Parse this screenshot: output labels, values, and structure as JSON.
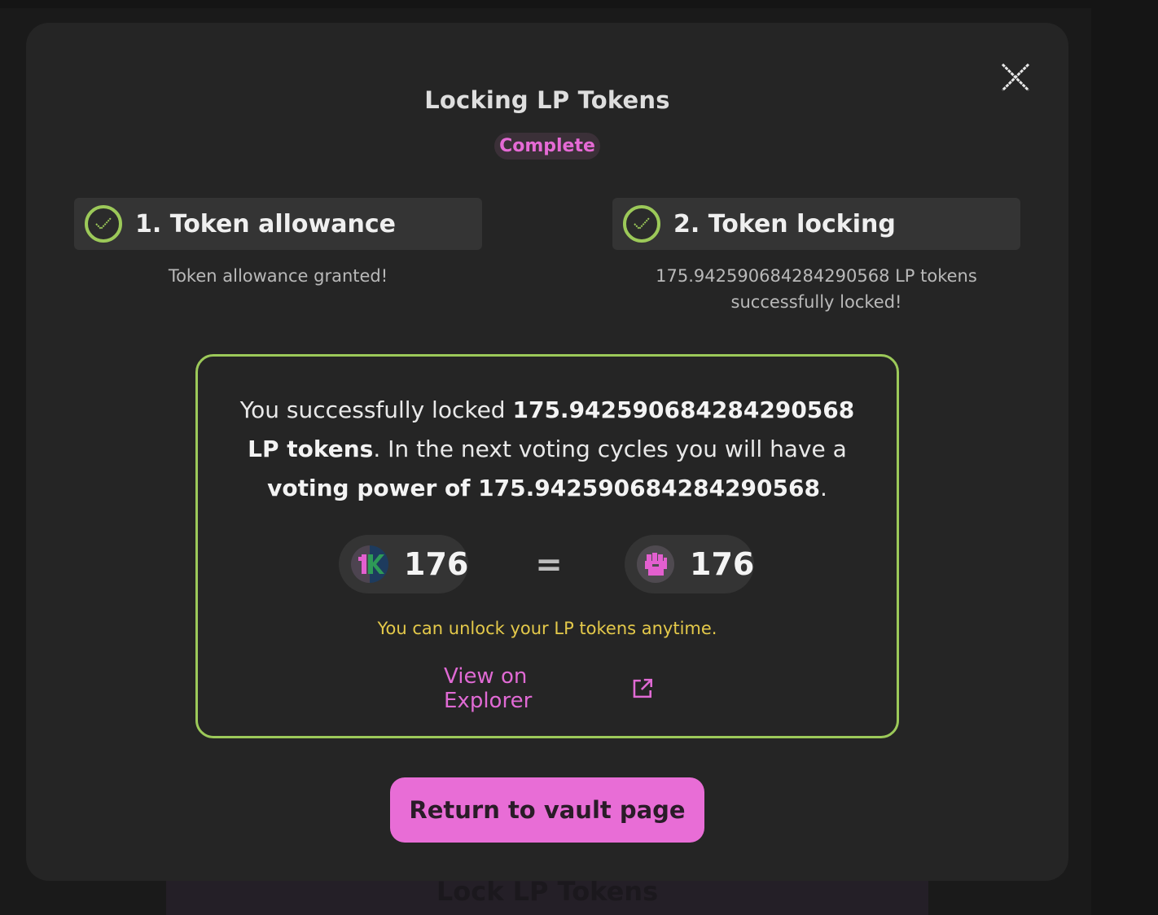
{
  "background": {
    "behind_button_label": "Lock LP Tokens"
  },
  "modal": {
    "title": "Locking LP Tokens",
    "status": "Complete",
    "steps": [
      {
        "label": "1. Token allowance",
        "state": "done",
        "description": "Token allowance granted!"
      },
      {
        "label": "2. Token locking",
        "state": "done",
        "description": "175.942590684284290568 LP tokens successfully locked!"
      }
    ],
    "success": {
      "text_1": "You successfully locked ",
      "locked_amount": "175.942590684284290568 LP tokens",
      "text_2": ". In the next voting cycles you will have a ",
      "voting_power": "voting power of 175.942590684284290568",
      "text_3": ".",
      "lp_value": "176",
      "equals": "=",
      "vp_value": "176",
      "unlock_note": "You can unlock your LP tokens anytime.",
      "explorer_link": "View on Explorer"
    },
    "return_button": "Return to vault page"
  },
  "icons": {
    "close": "close-icon",
    "check": "check-circle-icon",
    "lp_token": "lp-token-icon",
    "voting_power": "voting-power-fist-icon",
    "external_link": "external-link-icon"
  },
  "colors": {
    "accent_pink": "#e86dd6",
    "success_green": "#9cc959",
    "warning_yellow": "#e4c94a",
    "modal_bg": "#252525"
  }
}
